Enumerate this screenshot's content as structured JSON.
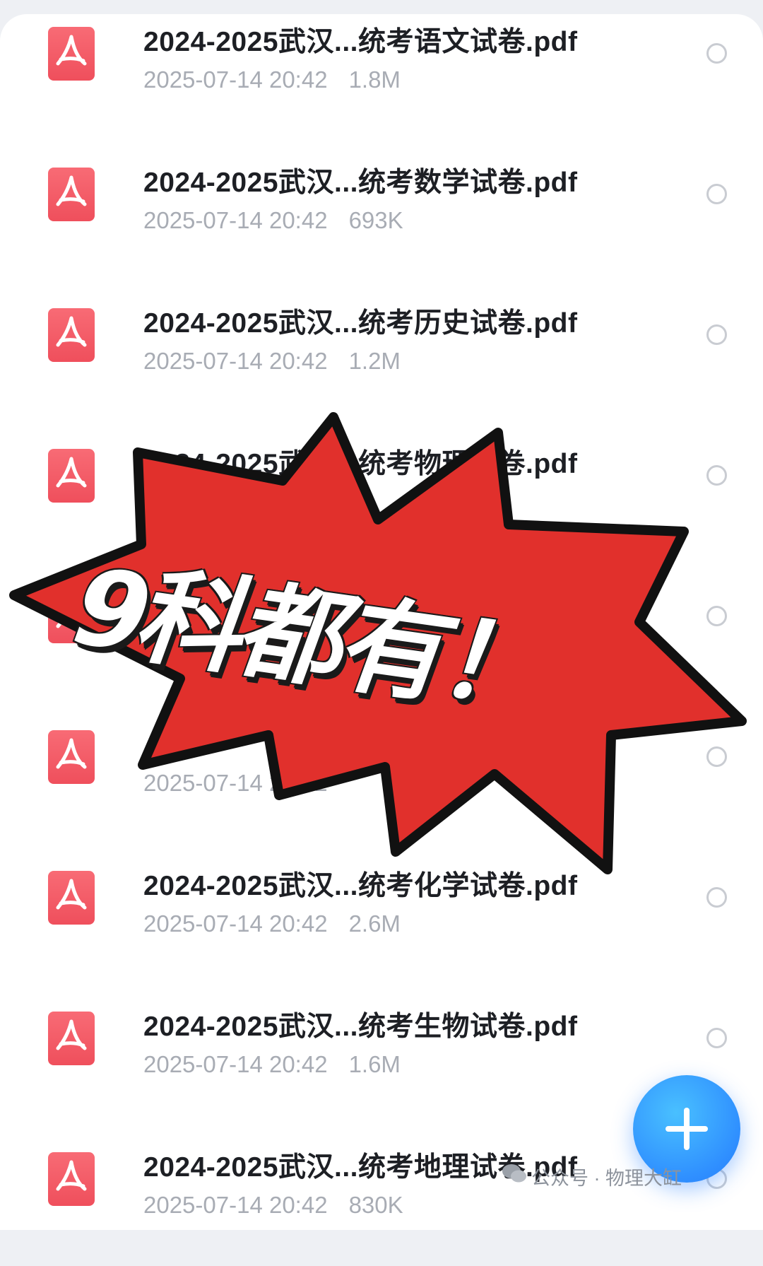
{
  "files": [
    {
      "name": "2024-2025武汉...统考语文试卷.pdf",
      "date": "2025-07-14 20:42",
      "size": "1.8M"
    },
    {
      "name": "2024-2025武汉...统考数学试卷.pdf",
      "date": "2025-07-14 20:42",
      "size": "693K"
    },
    {
      "name": "2024-2025武汉...统考历史试卷.pdf",
      "date": "2025-07-14 20:42",
      "size": "1.2M"
    },
    {
      "name": "2024-2025武汉...统考物理试卷.pdf",
      "date": "",
      "size": ""
    },
    {
      "name": "",
      "date": "",
      "size": ""
    },
    {
      "name": "",
      "date": "2025-07-14 20:42",
      "size": ""
    },
    {
      "name": "2024-2025武汉...统考化学试卷.pdf",
      "date": "2025-07-14 20:42",
      "size": "2.6M"
    },
    {
      "name": "2024-2025武汉...统考生物试卷.pdf",
      "date": "2025-07-14 20:42",
      "size": "1.6M"
    },
    {
      "name": "2024-2025武汉...统考地理试卷.pdf",
      "date": "2025-07-14 20:42",
      "size": "830K"
    }
  ],
  "overlay": {
    "text": "9科都有！",
    "color": "#e1302c"
  },
  "watermark": "公众号 · 物理大缸",
  "fab": {
    "icon": "plus-icon",
    "color": "#2f8fff"
  },
  "colors": {
    "pdf_icon": "#f05b66",
    "radio_border": "#c9ccd2"
  }
}
